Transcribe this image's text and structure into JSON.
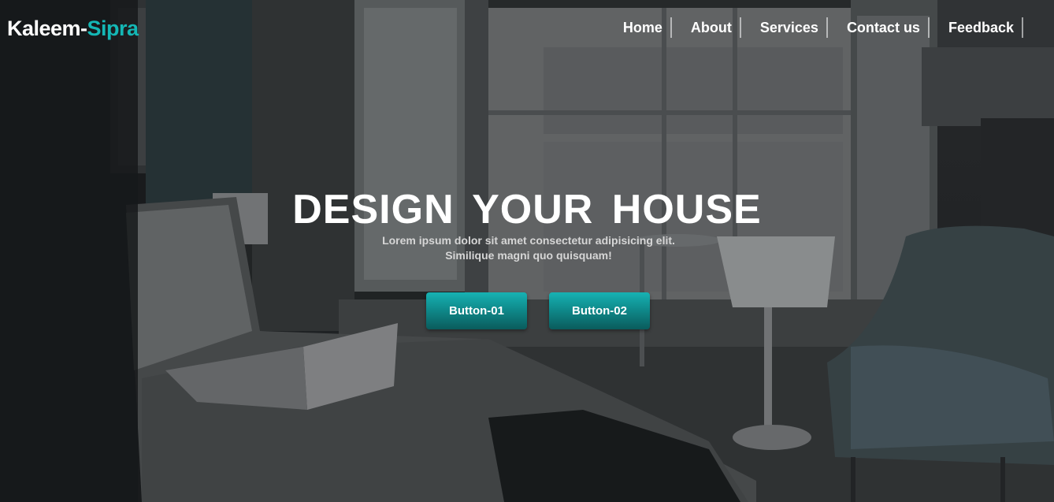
{
  "header": {
    "logo_main": "Kaleem-",
    "logo_accent": "Sipra",
    "nav": [
      {
        "label": "Home"
      },
      {
        "label": "About"
      },
      {
        "label": "Services"
      },
      {
        "label": "Contact us"
      },
      {
        "label": "Feedback"
      }
    ]
  },
  "hero": {
    "headline": "DESIGN YOUR HOUSE",
    "subtext": "Lorem ipsum dolor sit amet consectetur adipisicing elit. Similique magni quo quisquam!",
    "button1": "Button-01",
    "button2": "Button-02",
    "background_image": "dim-bedroom-photo"
  },
  "colors": {
    "accent": "#14b7b5",
    "button_top": "#17b2b3",
    "button_bottom": "#0a5b5c",
    "text": "#ffffff"
  }
}
